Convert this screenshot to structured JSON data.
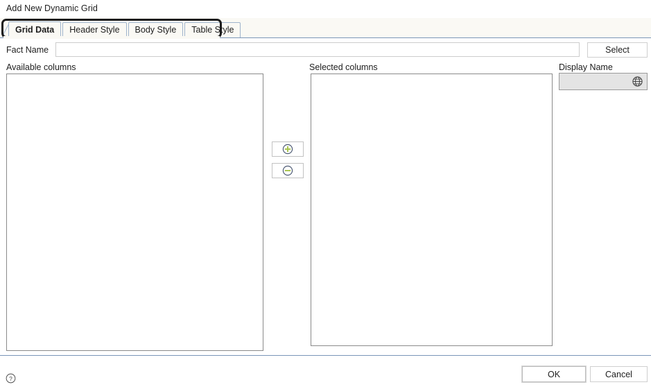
{
  "dialog": {
    "title": "Add New Dynamic Grid"
  },
  "tabs": [
    {
      "label": "Grid Data",
      "active": true
    },
    {
      "label": "Header Style",
      "active": false
    },
    {
      "label": "Body Style",
      "active": false
    },
    {
      "label": "Table Style",
      "active": false
    }
  ],
  "fact_name": {
    "label": "Fact Name",
    "value": "",
    "placeholder": ""
  },
  "select_button": {
    "label": "Select"
  },
  "available_columns": {
    "label": "Available columns",
    "items": []
  },
  "selected_columns": {
    "label": "Selected columns",
    "items": []
  },
  "display_name": {
    "label": "Display Name",
    "value": "",
    "enabled": false,
    "icon": "globe-icon"
  },
  "transfer_buttons": {
    "add": {
      "icon": "plus-circle-icon",
      "label": ""
    },
    "remove": {
      "icon": "minus-circle-icon",
      "label": ""
    }
  },
  "footer": {
    "help_icon": "question-mark-circle-icon",
    "ok_label": "OK",
    "cancel_label": "Cancel"
  },
  "colors": {
    "tab_strip_bg": "#faf9f4",
    "tab_border": "#9fb4cc",
    "separator_blue": "#7a96b8",
    "focus_ring": "#1c1c1c",
    "icon_green": "#a6c34a",
    "icon_circle": "#42506b",
    "disabled_field_bg": "#e4e4e4"
  }
}
